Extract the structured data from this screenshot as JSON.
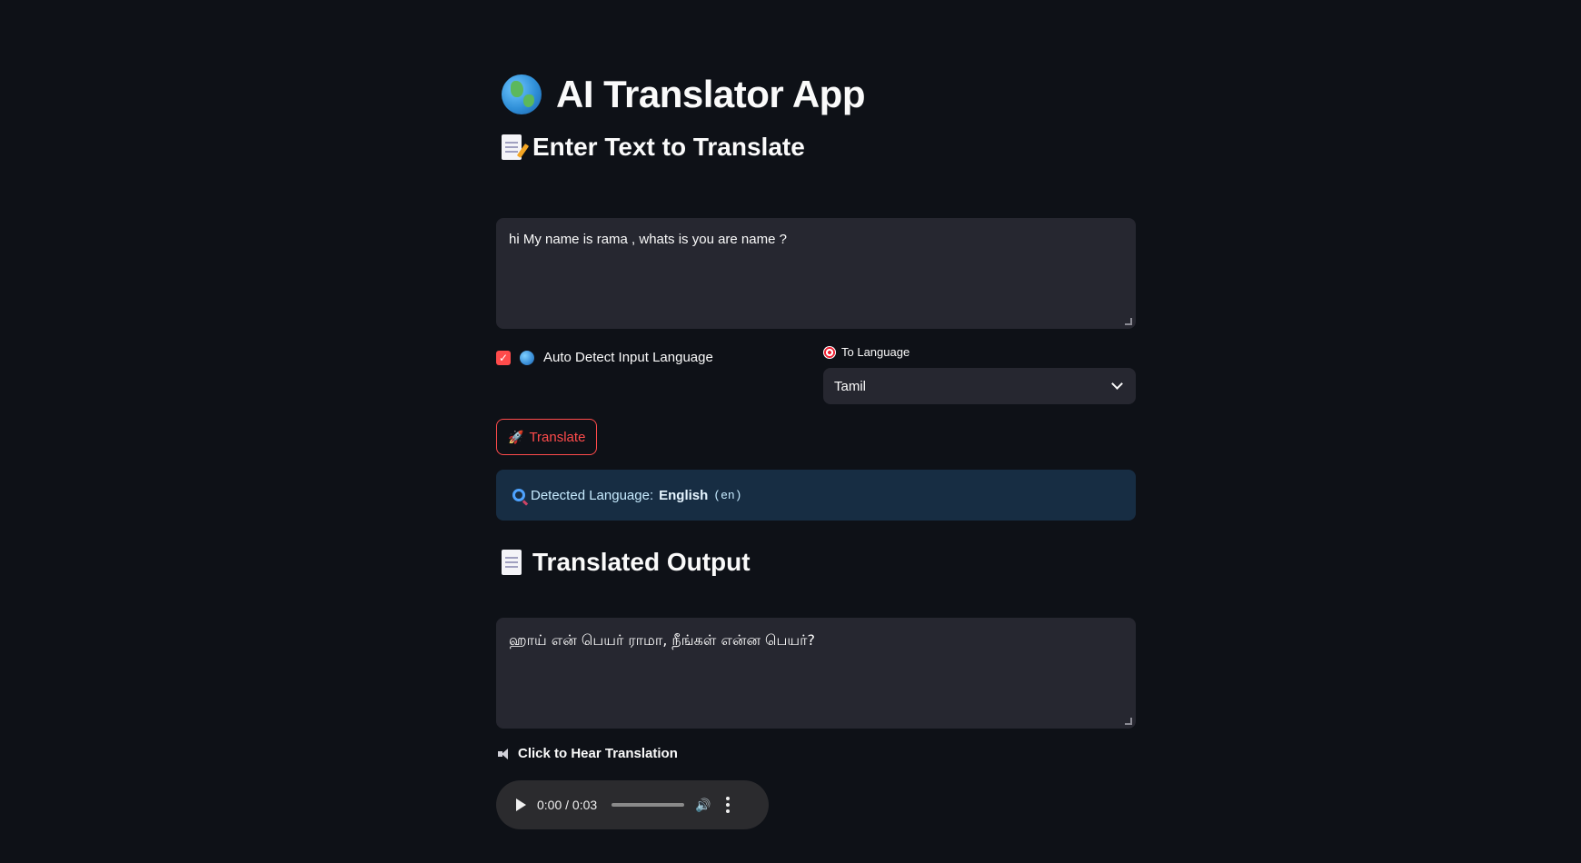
{
  "app": {
    "title": "AI Translator App"
  },
  "input_section": {
    "heading": "Enter Text to Translate",
    "text": "hi My name is rama , whats is you are name ?"
  },
  "options": {
    "auto_detect_label": "Auto Detect Input Language",
    "auto_detect_checked": true,
    "to_language_label": "To Language",
    "to_language_value": "Tamil"
  },
  "translate_button": {
    "label": "Translate"
  },
  "detection": {
    "prefix": "Detected Language:",
    "language": "English",
    "code": "(en)"
  },
  "output_section": {
    "heading": "Translated Output",
    "text": "ஹாய் என் பெயர் ராமா, நீங்கள் என்ன பெயர்?"
  },
  "audio": {
    "label": "Click to Hear Translation",
    "time": "0:00 / 0:03"
  },
  "colors": {
    "background": "#0e1117",
    "accent": "#ff4b4b",
    "input_bg": "#262730",
    "info_bg": "#172d43"
  }
}
